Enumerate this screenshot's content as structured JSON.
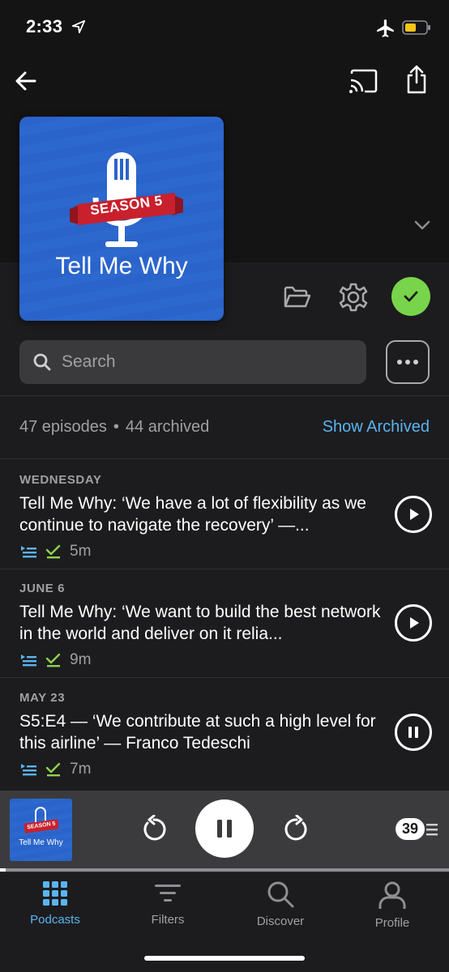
{
  "status_bar": {
    "time": "2:33"
  },
  "podcast": {
    "artwork_banner": "SEASON 5",
    "artwork_title": "Tell Me Why"
  },
  "search": {
    "placeholder": "Search"
  },
  "counts": {
    "episodes": "47 episodes",
    "separator": "•",
    "archived": "44 archived",
    "show_archived": "Show Archived"
  },
  "episodes": [
    {
      "date": "WEDNESDAY",
      "title": "Tell Me Why: ‘We have a lot of flexibility as we continue to navigate the recovery’ —...",
      "duration": "5m",
      "state": "play"
    },
    {
      "date": "JUNE 6",
      "title": "Tell Me Why: ‘We want to build the best network in the world and deliver on it relia...",
      "duration": "9m",
      "state": "play"
    },
    {
      "date": "MAY 23",
      "title": "S5:E4 — ‘We contribute at such a high level for this airline’ — Franco Tedeschi",
      "duration": "7m",
      "state": "pause"
    }
  ],
  "mini_player": {
    "artwork_title": "Tell Me Why",
    "artwork_banner": "SEASON 5",
    "queue_count": "39",
    "progress_fraction": 0.012
  },
  "tabs": [
    {
      "label": "Podcasts",
      "icon": "grid-icon",
      "active": true
    },
    {
      "label": "Filters",
      "icon": "filter-icon",
      "active": false
    },
    {
      "label": "Discover",
      "icon": "search-icon",
      "active": false
    },
    {
      "label": "Profile",
      "icon": "person-icon",
      "active": false
    }
  ],
  "colors": {
    "accent": "#5ab4f0",
    "check_green": "#78d44a",
    "artwork_blue": "#2a63c9",
    "banner_red": "#c8202c",
    "queue_icon_blue": "#5ab4f0",
    "played_check_green": "#8fd14f"
  }
}
